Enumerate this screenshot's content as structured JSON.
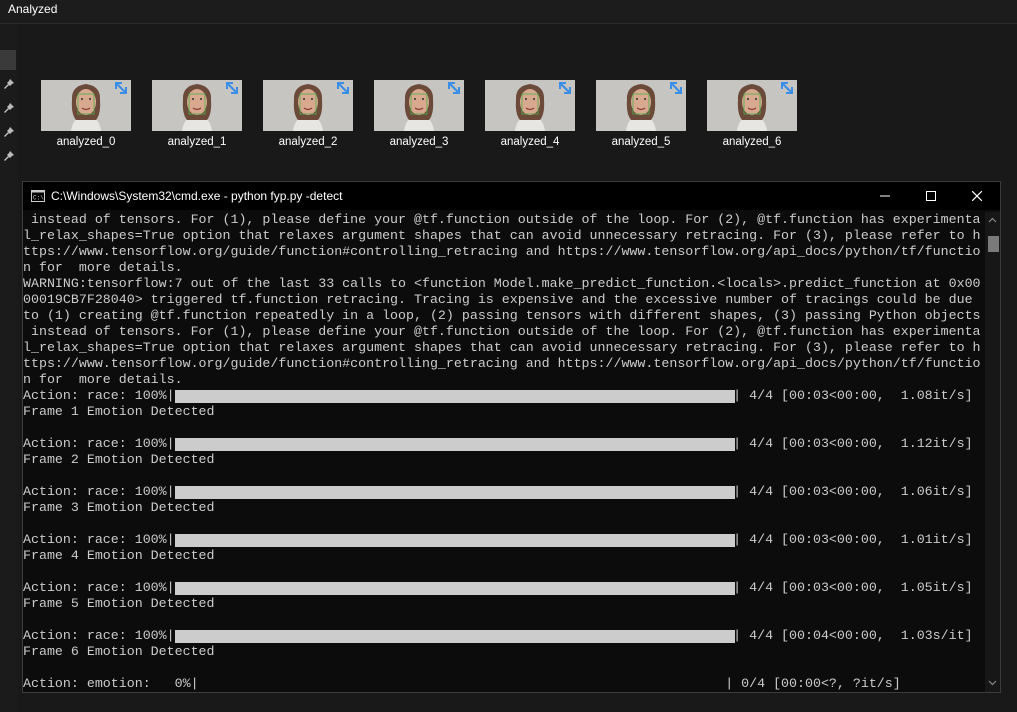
{
  "explorer": {
    "title": "Analyzed",
    "thumbnails": [
      {
        "label": "analyzed_0"
      },
      {
        "label": "analyzed_1"
      },
      {
        "label": "analyzed_2"
      },
      {
        "label": "analyzed_3"
      },
      {
        "label": "analyzed_4"
      },
      {
        "label": "analyzed_5"
      },
      {
        "label": "analyzed_6"
      }
    ]
  },
  "cmd": {
    "title": "C:\\Windows\\System32\\cmd.exe - python  fyp.py -detect",
    "lines": [
      {
        "text": " instead of tensors. For (1), please define your @tf.function outside of the loop. For (2), @tf.function has experimenta"
      },
      {
        "text": "l_relax_shapes=True option that relaxes argument shapes that can avoid unnecessary retracing. For (3), please refer to h"
      },
      {
        "text": "ttps://www.tensorflow.org/guide/function#controlling_retracing and https://www.tensorflow.org/api_docs/python/tf/functio"
      },
      {
        "text": "n for  more details."
      },
      {
        "text": "WARNING:tensorflow:7 out of the last 33 calls to <function Model.make_predict_function.<locals>.predict_function at 0x00"
      },
      {
        "text": "00019CB7F28040> triggered tf.function retracing. Tracing is expensive and the excessive number of tracings could be due"
      },
      {
        "text": "to (1) creating @tf.function repeatedly in a loop, (2) passing tensors with different shapes, (3) passing Python objects"
      },
      {
        "text": " instead of tensors. For (1), please define your @tf.function outside of the loop. For (2), @tf.function has experimenta"
      },
      {
        "text": "l_relax_shapes=True option that relaxes argument shapes that can avoid unnecessary retracing. For (3), please refer to h"
      },
      {
        "text": "ttps://www.tensorflow.org/guide/function#controlling_retracing and https://www.tensorflow.org/api_docs/python/tf/functio"
      },
      {
        "text": "n for  more details."
      },
      {
        "text": "Action: race: 100%|                                                                      | 4/4 [00:03<00:00,  1.08it/s]",
        "progress": 1.0
      },
      {
        "text": "Frame 1 Emotion Detected"
      },
      {
        "text": ""
      },
      {
        "text": "Action: race: 100%|                                                                      | 4/4 [00:03<00:00,  1.12it/s]",
        "progress": 1.0
      },
      {
        "text": "Frame 2 Emotion Detected"
      },
      {
        "text": ""
      },
      {
        "text": "Action: race: 100%|                                                                      | 4/4 [00:03<00:00,  1.06it/s]",
        "progress": 1.0
      },
      {
        "text": "Frame 3 Emotion Detected"
      },
      {
        "text": ""
      },
      {
        "text": "Action: race: 100%|                                                                      | 4/4 [00:03<00:00,  1.01it/s]",
        "progress": 1.0
      },
      {
        "text": "Frame 4 Emotion Detected"
      },
      {
        "text": ""
      },
      {
        "text": "Action: race: 100%|                                                                      | 4/4 [00:03<00:00,  1.05it/s]",
        "progress": 1.0
      },
      {
        "text": "Frame 5 Emotion Detected"
      },
      {
        "text": ""
      },
      {
        "text": "Action: race: 100%|                                                                      | 4/4 [00:04<00:00,  1.03s/it]",
        "progress": 1.0
      },
      {
        "text": "Frame 6 Emotion Detected"
      },
      {
        "text": ""
      },
      {
        "text": "Action: emotion:   0%|                                                                  | 0/4 [00:00<?, ?it/s]",
        "progress": 0.0
      }
    ]
  },
  "colors": {
    "console_text": "#cccccc",
    "console_bg": "#0c0c0c",
    "progress_fill": "#cccccc",
    "explorer_bg": "#191919",
    "badge_blue": "#3b8ee6"
  }
}
